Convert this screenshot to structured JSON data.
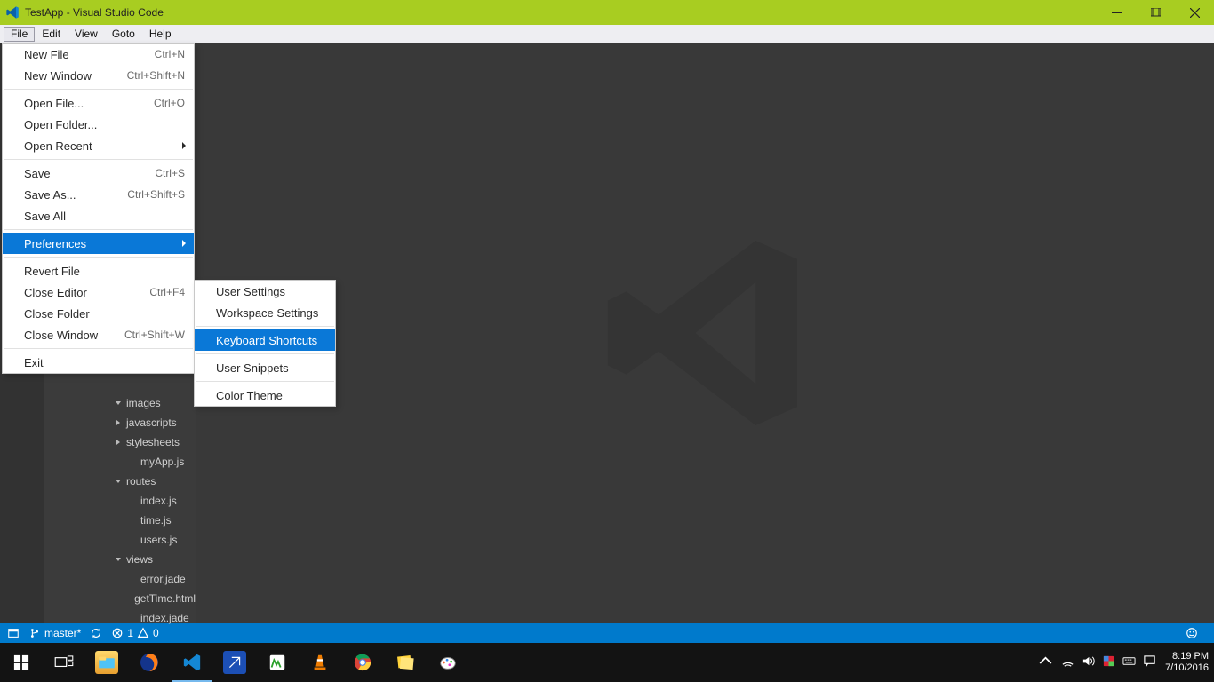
{
  "title": "TestApp - Visual Studio Code",
  "menubar": [
    "File",
    "Edit",
    "View",
    "Goto",
    "Help"
  ],
  "file_menu": [
    {
      "label": "New File",
      "shortcut": "Ctrl+N"
    },
    {
      "label": "New Window",
      "shortcut": "Ctrl+Shift+N"
    },
    {
      "type": "sep"
    },
    {
      "label": "Open File...",
      "shortcut": "Ctrl+O"
    },
    {
      "label": "Open Folder..."
    },
    {
      "label": "Open Recent",
      "submenu": true
    },
    {
      "type": "sep"
    },
    {
      "label": "Save",
      "shortcut": "Ctrl+S"
    },
    {
      "label": "Save As...",
      "shortcut": "Ctrl+Shift+S"
    },
    {
      "label": "Save All"
    },
    {
      "type": "sep"
    },
    {
      "label": "Preferences",
      "submenu": true,
      "highlight": true
    },
    {
      "type": "sep"
    },
    {
      "label": "Revert File"
    },
    {
      "label": "Close Editor",
      "shortcut": "Ctrl+F4"
    },
    {
      "label": "Close Folder"
    },
    {
      "label": "Close Window",
      "shortcut": "Ctrl+Shift+W"
    },
    {
      "type": "sep"
    },
    {
      "label": "Exit"
    }
  ],
  "preferences_submenu": [
    {
      "label": "User Settings"
    },
    {
      "label": "Workspace Settings"
    },
    {
      "type": "sep"
    },
    {
      "label": "Keyboard Shortcuts",
      "highlight": true
    },
    {
      "type": "sep"
    },
    {
      "label": "User Snippets"
    },
    {
      "type": "sep"
    },
    {
      "label": "Color Theme"
    }
  ],
  "explorer_tree": [
    {
      "label": "images",
      "twisty": "open",
      "depth": 1
    },
    {
      "label": "javascripts",
      "twisty": "closed",
      "depth": 1
    },
    {
      "label": "stylesheets",
      "twisty": "closed",
      "depth": 1
    },
    {
      "label": "myApp.js",
      "depth": 2
    },
    {
      "label": "routes",
      "twisty": "open",
      "depth": 1
    },
    {
      "label": "index.js",
      "depth": 2
    },
    {
      "label": "time.js",
      "depth": 2
    },
    {
      "label": "users.js",
      "depth": 2
    },
    {
      "label": "views",
      "twisty": "open",
      "depth": 1
    },
    {
      "label": "error.jade",
      "depth": 2
    },
    {
      "label": "getTime.html",
      "depth": 2
    },
    {
      "label": "index.jade",
      "depth": 2
    }
  ],
  "statusbar": {
    "branch": "master*",
    "errors": "1",
    "warnings": "0"
  },
  "clock": {
    "time": "8:19 PM",
    "date": "7/10/2016"
  }
}
